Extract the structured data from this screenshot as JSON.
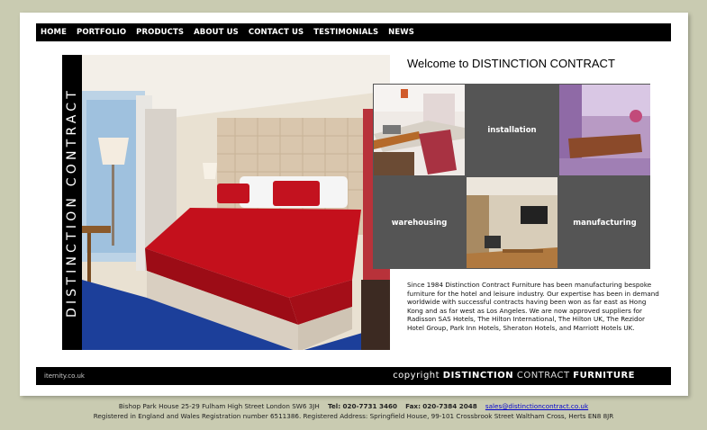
{
  "nav": {
    "items": [
      "HOME",
      "PORTFOLIO",
      "PRODUCTS",
      "ABOUT US",
      "CONTACT US",
      "TESTIMONIALS",
      "NEWS"
    ]
  },
  "brand": {
    "vertical_logo": "DISTINCTION CONTRACT"
  },
  "main": {
    "welcome": "Welcome to DISTINCTION CONTRACT",
    "tiles": {
      "installation": "installation",
      "warehousing": "warehousing",
      "manufacturing": "manufacturing"
    },
    "intro": "Since 1984 Distinction Contract Furniture has been manufacturing bespoke furniture for the hotel and leisure industry. Our expertise has been in demand worldwide with successful contracts having been won as far east as Hong Kong and as far west as Los Angeles. We are now approved suppliers for Radisson SAS Hotels, The Hilton International, The Hilton UK, The Rezidor Hotel Group, Park Inn Hotels, Sheraton Hotels, and Marriott Hotels UK."
  },
  "footer": {
    "credit": "iternity.co.uk",
    "copyright_prefix": "copyright",
    "copyright_word1": "DISTINCTION",
    "copyright_word2": "CONTRACT",
    "copyright_word3": "FURNITURE"
  },
  "address": {
    "line1_text": "Bishop Park House 25-29 Fulham High Street London SW6 3JH",
    "tel_label": "Tel:",
    "tel": "020-7731 3460",
    "fax_label": "Fax:",
    "fax": "020-7384 2048",
    "email": "sales@distinctioncontract.co.uk",
    "line2": "Registered in England and Wales   Registration number 6511386.   Registered Address: Springfield House, 99-101 Crossbrook Street Waltham Cross, Herts EN8 8JR"
  },
  "colors": {
    "background": "#c9cbb1",
    "bar": "#000000",
    "tile_grey": "#555555",
    "link": "#0000cc"
  }
}
